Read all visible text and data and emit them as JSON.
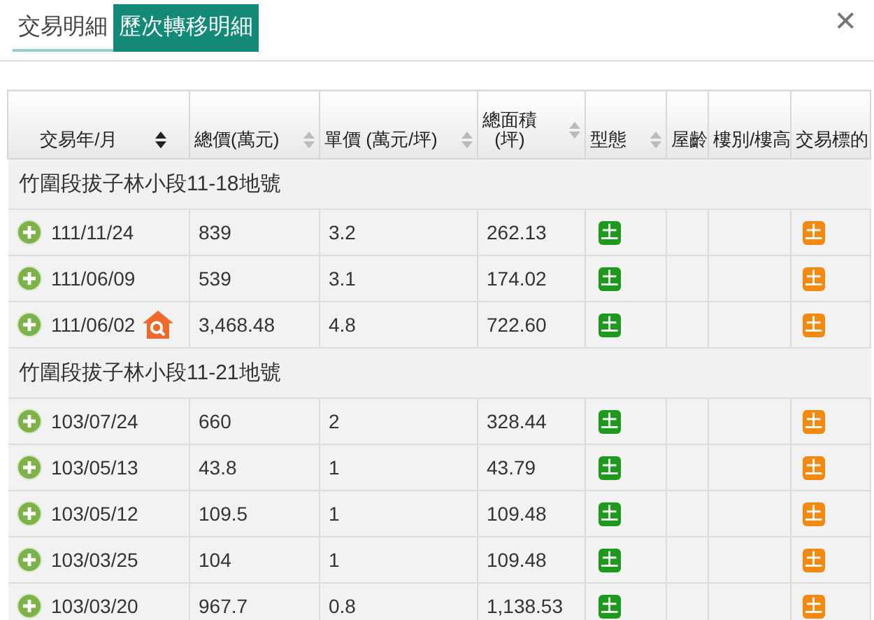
{
  "tabs": [
    {
      "label": "交易明細",
      "selected": false
    },
    {
      "label": "歷次轉移明細",
      "selected": true
    }
  ],
  "close": "✕",
  "table": {
    "columns": [
      {
        "label": "交易年/月",
        "sortable": true,
        "sorted": true
      },
      {
        "label": "總價(萬元)",
        "sortable": true,
        "sorted": false
      },
      {
        "label": "單價 (萬元/坪)",
        "sortable": true,
        "sorted": false
      },
      {
        "label": "總面積\n(坪)",
        "sortable": true,
        "sorted": false
      },
      {
        "label": "型態",
        "sortable": true,
        "sorted": false
      },
      {
        "label": "屋齡",
        "sortable": false
      },
      {
        "label": "樓別/樓高",
        "sortable": false
      },
      {
        "label": "交易標的",
        "sortable": false
      }
    ],
    "groups": [
      {
        "title": "竹圍段拔子林小段11-18地號",
        "rows": [
          {
            "date": "111/11/24",
            "total": "839",
            "unit": "3.2",
            "area": "262.13",
            "type": "土",
            "target": "土",
            "listing": false
          },
          {
            "date": "111/06/09",
            "total": "539",
            "unit": "3.1",
            "area": "174.02",
            "type": "土",
            "target": "土",
            "listing": false
          },
          {
            "date": "111/06/02",
            "total": "3,468.48",
            "unit": "4.8",
            "area": "722.60",
            "type": "土",
            "target": "土",
            "listing": true
          }
        ]
      },
      {
        "title": "竹圍段拔子林小段11-21地號",
        "rows": [
          {
            "date": "103/07/24",
            "total": "660",
            "unit": "2",
            "area": "328.44",
            "type": "土",
            "target": "土",
            "listing": false
          },
          {
            "date": "103/05/13",
            "total": "43.8",
            "unit": "1",
            "area": "43.79",
            "type": "土",
            "target": "土",
            "listing": false
          },
          {
            "date": "103/05/12",
            "total": "109.5",
            "unit": "1",
            "area": "109.48",
            "type": "土",
            "target": "土",
            "listing": false
          },
          {
            "date": "103/03/25",
            "total": "104",
            "unit": "1",
            "area": "109.48",
            "type": "土",
            "target": "土",
            "listing": false
          },
          {
            "date": "103/03/20",
            "total": "967.7",
            "unit": "0.8",
            "area": "1,138.53",
            "type": "土",
            "target": "土",
            "listing": false
          }
        ]
      }
    ]
  }
}
